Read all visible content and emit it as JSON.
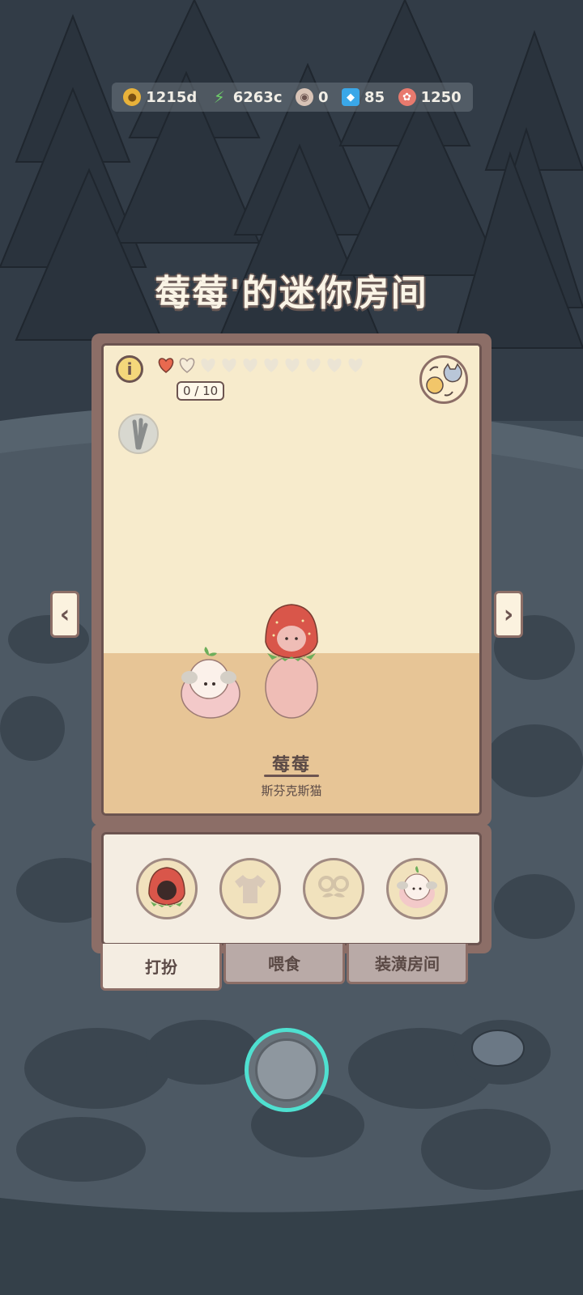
{
  "resources": [
    {
      "icon": "coin-icon",
      "value": "1215d",
      "color": "#e8b23a"
    },
    {
      "icon": "energy-bolt-icon",
      "value": "6263c",
      "color": "#6fd16a"
    },
    {
      "icon": "yarn-ball-icon",
      "value": "0",
      "color": "#d8c3b6"
    },
    {
      "icon": "gem-icon",
      "value": "85",
      "color": "#3aa7e8"
    },
    {
      "icon": "candy-icon",
      "value": "1250",
      "color": "#e87a6e"
    }
  ],
  "title": "莓莓'的迷你房间",
  "room": {
    "info_label": "i",
    "hearts_filled": 1,
    "hearts_total": 10,
    "progress": "0 / 10",
    "pet_name": "莓莓",
    "pet_breed": "斯芬克斯猫"
  },
  "nav": {
    "prev": "‹",
    "next": "›"
  },
  "items": [
    {
      "name": "strawberry-hat-slot"
    },
    {
      "name": "shirt-slot"
    },
    {
      "name": "glasses-slot"
    },
    {
      "name": "sheep-costume-slot"
    }
  ],
  "tabs": [
    {
      "label": "打扮",
      "active": true
    },
    {
      "label": "喂食",
      "active": false
    },
    {
      "label": "装潢房间",
      "active": false
    }
  ],
  "colors": {
    "accent": "#4fe0d0",
    "frame": "#8c6e67",
    "heart": "#e8694f"
  }
}
